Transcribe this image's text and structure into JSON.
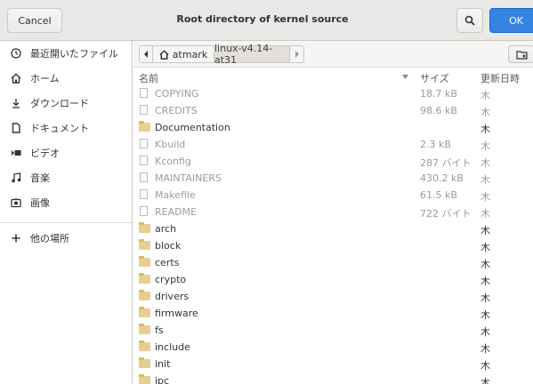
{
  "header": {
    "cancel_label": "Cancel",
    "title": "Root directory of kernel source",
    "ok_label": "OK"
  },
  "sidebar": {
    "items": [
      {
        "label": "最近開いたファイル",
        "icon": "recent-clock-icon"
      },
      {
        "label": "ホーム",
        "icon": "home-icon"
      },
      {
        "label": "ダウンロード",
        "icon": "download-icon"
      },
      {
        "label": "ドキュメント",
        "icon": "document-icon"
      },
      {
        "label": "ビデオ",
        "icon": "video-icon"
      },
      {
        "label": "音楽",
        "icon": "music-icon"
      },
      {
        "label": "画像",
        "icon": "image-icon"
      }
    ],
    "other_locations": "他の場所"
  },
  "pathbar": {
    "home_label": "atmark",
    "current_label": "linux-v4.14-at31"
  },
  "columns": {
    "name": "名前",
    "size": "サイズ",
    "modified": "更新日時"
  },
  "files": [
    {
      "name": "COPYING",
      "size": "18.7 kB",
      "modified": "木",
      "type": "file"
    },
    {
      "name": "CREDITS",
      "size": "98.6 kB",
      "modified": "木",
      "type": "file"
    },
    {
      "name": "Documentation",
      "size": "",
      "modified": "木",
      "type": "folder"
    },
    {
      "name": "Kbuild",
      "size": "2.3 kB",
      "modified": "木",
      "type": "file"
    },
    {
      "name": "Kconfig",
      "size": "287 バイト",
      "modified": "木",
      "type": "file"
    },
    {
      "name": "MAINTAINERS",
      "size": "430.2 kB",
      "modified": "木",
      "type": "file"
    },
    {
      "name": "Makefile",
      "size": "61.5 kB",
      "modified": "木",
      "type": "file"
    },
    {
      "name": "README",
      "size": "722 バイト",
      "modified": "木",
      "type": "file"
    },
    {
      "name": "arch",
      "size": "",
      "modified": "木",
      "type": "folder"
    },
    {
      "name": "block",
      "size": "",
      "modified": "木",
      "type": "folder"
    },
    {
      "name": "certs",
      "size": "",
      "modified": "木",
      "type": "folder"
    },
    {
      "name": "crypto",
      "size": "",
      "modified": "木",
      "type": "folder"
    },
    {
      "name": "drivers",
      "size": "",
      "modified": "木",
      "type": "folder"
    },
    {
      "name": "firmware",
      "size": "",
      "modified": "木",
      "type": "folder"
    },
    {
      "name": "fs",
      "size": "",
      "modified": "木",
      "type": "folder"
    },
    {
      "name": "include",
      "size": "",
      "modified": "木",
      "type": "folder"
    },
    {
      "name": "init",
      "size": "",
      "modified": "木",
      "type": "folder"
    },
    {
      "name": "ipc",
      "size": "",
      "modified": "木",
      "type": "folder"
    }
  ],
  "colors": {
    "accent": "#3584e4",
    "dimmed_text": "#9a9b9c",
    "folder": "#e7cf8f"
  }
}
